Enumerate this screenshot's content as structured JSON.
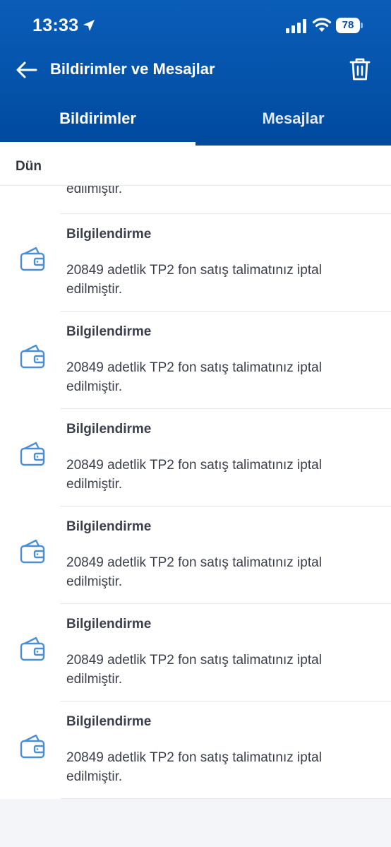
{
  "status_bar": {
    "time": "13:33",
    "battery": "78",
    "icons": [
      "location-arrow-icon",
      "cellular-signal-icon",
      "wifi-icon",
      "battery-icon"
    ]
  },
  "nav": {
    "title": "Bildirimler ve Mesajlar",
    "back_icon": "arrow-left-icon",
    "delete_icon": "trash-icon"
  },
  "tabs": [
    {
      "label": "Bildirimler",
      "active": true
    },
    {
      "label": "Mesajlar",
      "active": false
    }
  ],
  "section": {
    "label": "Dün"
  },
  "partial_item": {
    "body_tail": "edilmiştir."
  },
  "notifications": [
    {
      "title": "Bilgilendirme",
      "body": "20849 adetlik TP2 fon satış talimatınız iptal edilmiştir.",
      "icon": "wallet-icon"
    },
    {
      "title": "Bilgilendirme",
      "body": "20849 adetlik TP2 fon satış talimatınız iptal edilmiştir.",
      "icon": "wallet-icon"
    },
    {
      "title": "Bilgilendirme",
      "body": "20849 adetlik TP2 fon satış talimatınız iptal edilmiştir.",
      "icon": "wallet-icon"
    },
    {
      "title": "Bilgilendirme",
      "body": "20849 adetlik TP2 fon satış talimatınız iptal edilmiştir.",
      "icon": "wallet-icon"
    },
    {
      "title": "Bilgilendirme",
      "body": "20849 adetlik TP2 fon satış talimatınız iptal edilmiştir.",
      "icon": "wallet-icon"
    },
    {
      "title": "Bilgilendirme",
      "body": "20849 adetlik TP2 fon satış talimatınız iptal edilmiştir.",
      "icon": "wallet-icon"
    }
  ],
  "colors": {
    "header_bg": "#004a9f",
    "icon_blue": "#4a8fd6",
    "text": "#3a3f4b"
  }
}
